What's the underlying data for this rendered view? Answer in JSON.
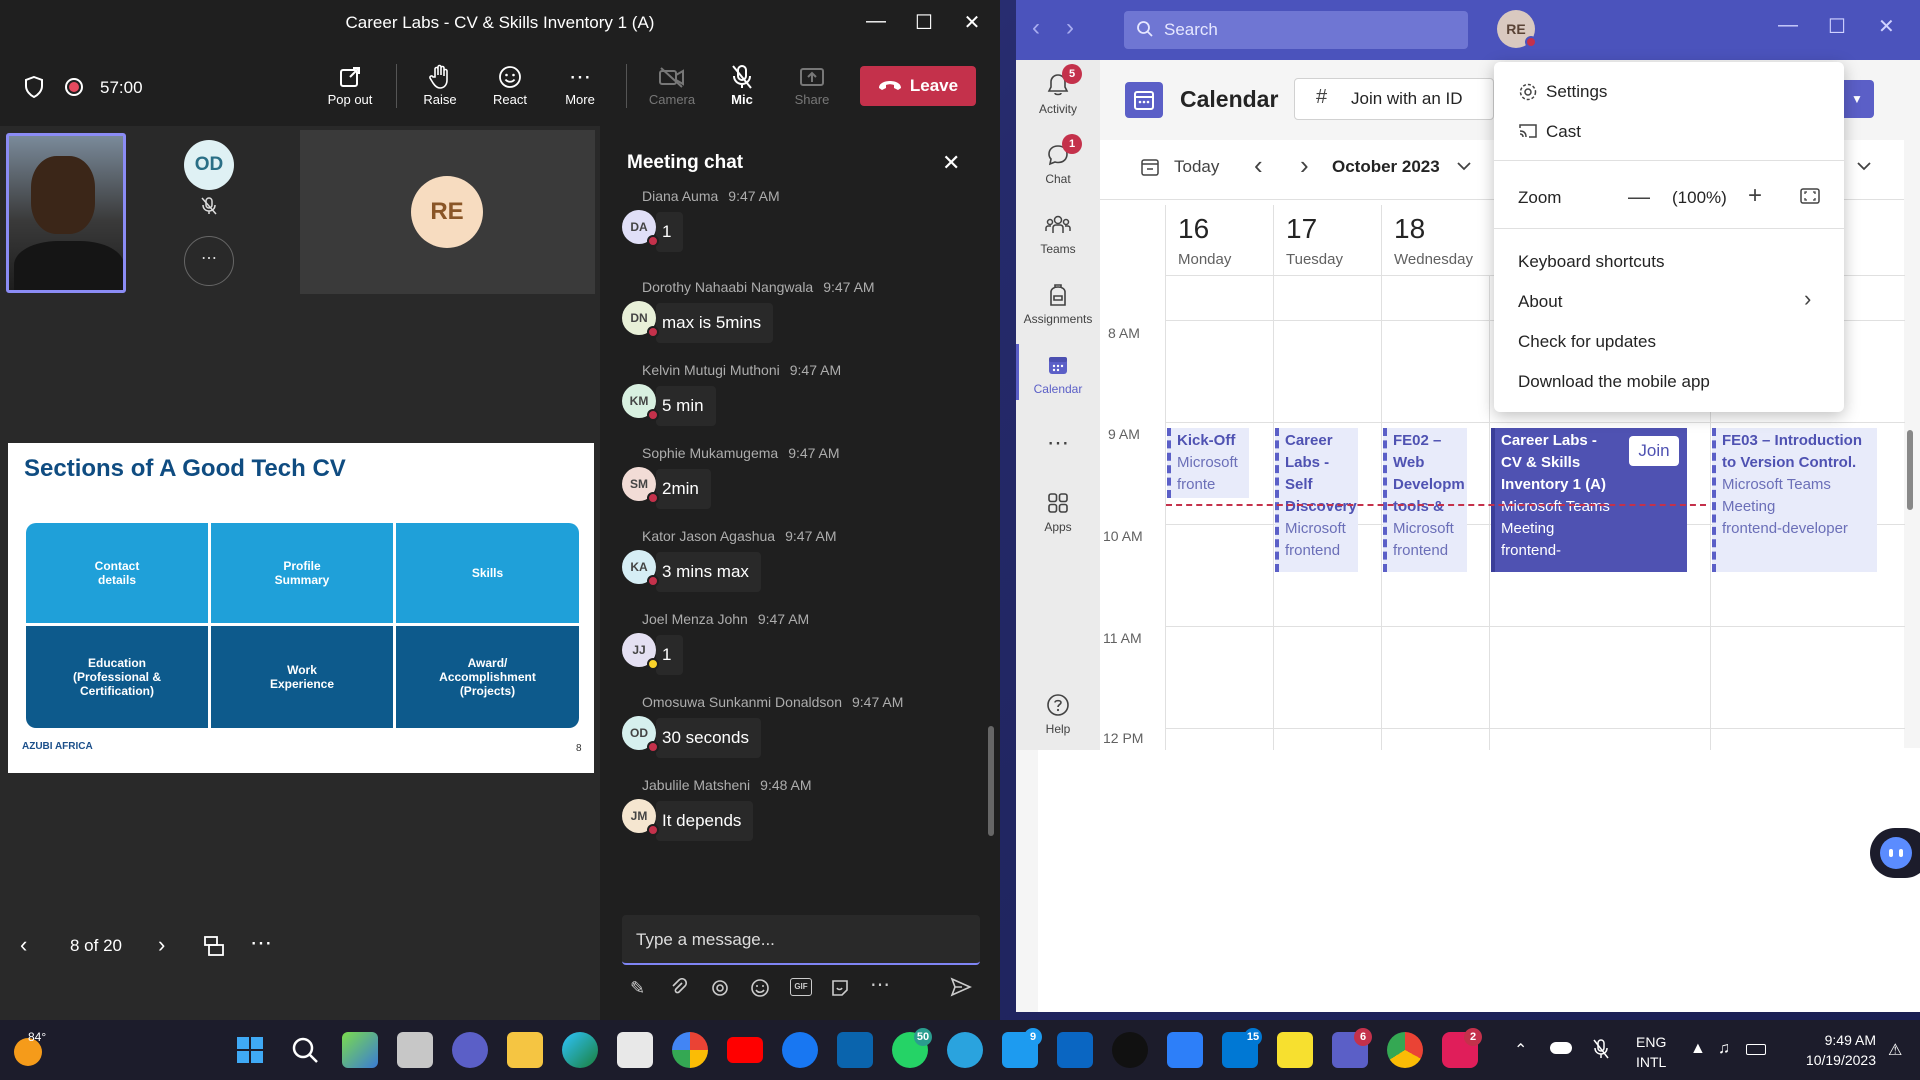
{
  "meeting": {
    "window_title": "Career Labs - CV & Skills Inventory 1 (A)",
    "timer": "57:00",
    "toolbar": {
      "pop_out": "Pop out",
      "raise": "Raise",
      "react": "React",
      "more": "More",
      "camera": "Camera",
      "mic": "Mic",
      "share": "Share",
      "leave": "Leave"
    },
    "participants": {
      "od": "OD",
      "re": "RE"
    },
    "slide": {
      "title": "Sections of A Good Tech CV",
      "cells": [
        "Contact details",
        "Profile Summary",
        "Skills",
        "Education (Professional & Certification)",
        "Work Experience",
        "Award/ Accomplishment (Projects)"
      ],
      "page_number": "8",
      "logo": "AZUBI AFRICA"
    },
    "pager": {
      "label": "8 of 20"
    },
    "chat": {
      "title": "Meeting chat",
      "messages": [
        {
          "author": "Diana Auma",
          "time": "9:47 AM",
          "initials": "DA",
          "text": "1",
          "color": "#e0dff7",
          "status": "busy"
        },
        {
          "author": "Dorothy Nahaabi Nangwala",
          "time": "9:47 AM",
          "initials": "DN",
          "text": "max is 5mins",
          "color": "#e8f0d8",
          "status": "busy"
        },
        {
          "author": "Kelvin Mutugi Muthoni",
          "time": "9:47 AM",
          "initials": "KM",
          "text": "5 min",
          "color": "#d8f0e0",
          "status": "busy"
        },
        {
          "author": "Sophie Mukamugema",
          "time": "9:47 AM",
          "initials": "SM",
          "text": "2min",
          "color": "#f2dcd6",
          "status": "busy"
        },
        {
          "author": "Kator Jason Agashua",
          "time": "9:47 AM",
          "initials": "KA",
          "text": "3 mins max",
          "color": "#d6eef5",
          "status": "busy"
        },
        {
          "author": "Joel Menza John",
          "time": "9:47 AM",
          "initials": "JJ",
          "text": "1",
          "color": "#e4e0f2",
          "status": "away"
        },
        {
          "author": "Omosuwa Sunkanmi Donaldson",
          "time": "9:47 AM",
          "initials": "OD",
          "text": "30 seconds",
          "color": "#d6f0ee",
          "status": "busy"
        },
        {
          "author": "Jabulile Matsheni",
          "time": "9:48 AM",
          "initials": "JM",
          "text": "It depends",
          "color": "#f5e6d0",
          "status": "busy"
        }
      ],
      "compose_placeholder": "Type a message..."
    }
  },
  "teams": {
    "search_placeholder": "Search",
    "user_initials": "RE",
    "rail": [
      {
        "label": "Activity",
        "badge": "5"
      },
      {
        "label": "Chat",
        "badge": "1"
      },
      {
        "label": "Teams",
        "badge": ""
      },
      {
        "label": "Assignments",
        "badge": ""
      },
      {
        "label": "Calendar",
        "badge": ""
      },
      {
        "label": "Apps",
        "badge": ""
      },
      {
        "label": "Help",
        "badge": ""
      }
    ],
    "calendar": {
      "title": "Calendar",
      "join_with_id": "Join with an ID",
      "today": "Today",
      "month": "October 2023",
      "days": [
        {
          "num": "16",
          "name": "Monday"
        },
        {
          "num": "17",
          "name": "Tuesday"
        },
        {
          "num": "18",
          "name": "Wednesday"
        }
      ],
      "times": [
        "8 AM",
        "9 AM",
        "10 AM",
        "11 AM",
        "12 PM"
      ],
      "events": [
        {
          "title": "Kick-Off",
          "line1": "Microsoft",
          "line2": "fronte"
        },
        {
          "title": "Career Labs - Self Discovery",
          "line1": "Microsoft",
          "line2": "frontend"
        },
        {
          "title": "FE02 – Web Developm tools &",
          "line1": "Microsoft",
          "line2": "frontend"
        },
        {
          "title": "Career Labs - CV & Skills Inventory 1 (A)",
          "line1": "Microsoft Teams Meeting",
          "line2": "frontend-"
        },
        {
          "title": "FE03 – Introduction to Version Control.",
          "line1": "Microsoft Teams Meeting",
          "line2": "frontend-developer"
        }
      ],
      "join_button": "Join"
    },
    "menu": {
      "settings": "Settings",
      "cast": "Cast",
      "zoom": "Zoom",
      "zoom_value": "(100%)",
      "keyboard_shortcuts": "Keyboard shortcuts",
      "about": "About",
      "check_updates": "Check for updates",
      "download_app": "Download the mobile app"
    }
  },
  "taskbar": {
    "weather": "84°",
    "language_line1": "ENG",
    "language_line2": "INTL",
    "time": "9:49 AM",
    "date": "10/19/2023",
    "badges": {
      "whatsapp": "50",
      "twitter": "9",
      "mail": "15",
      "teams": "6",
      "slack": "2"
    }
  }
}
